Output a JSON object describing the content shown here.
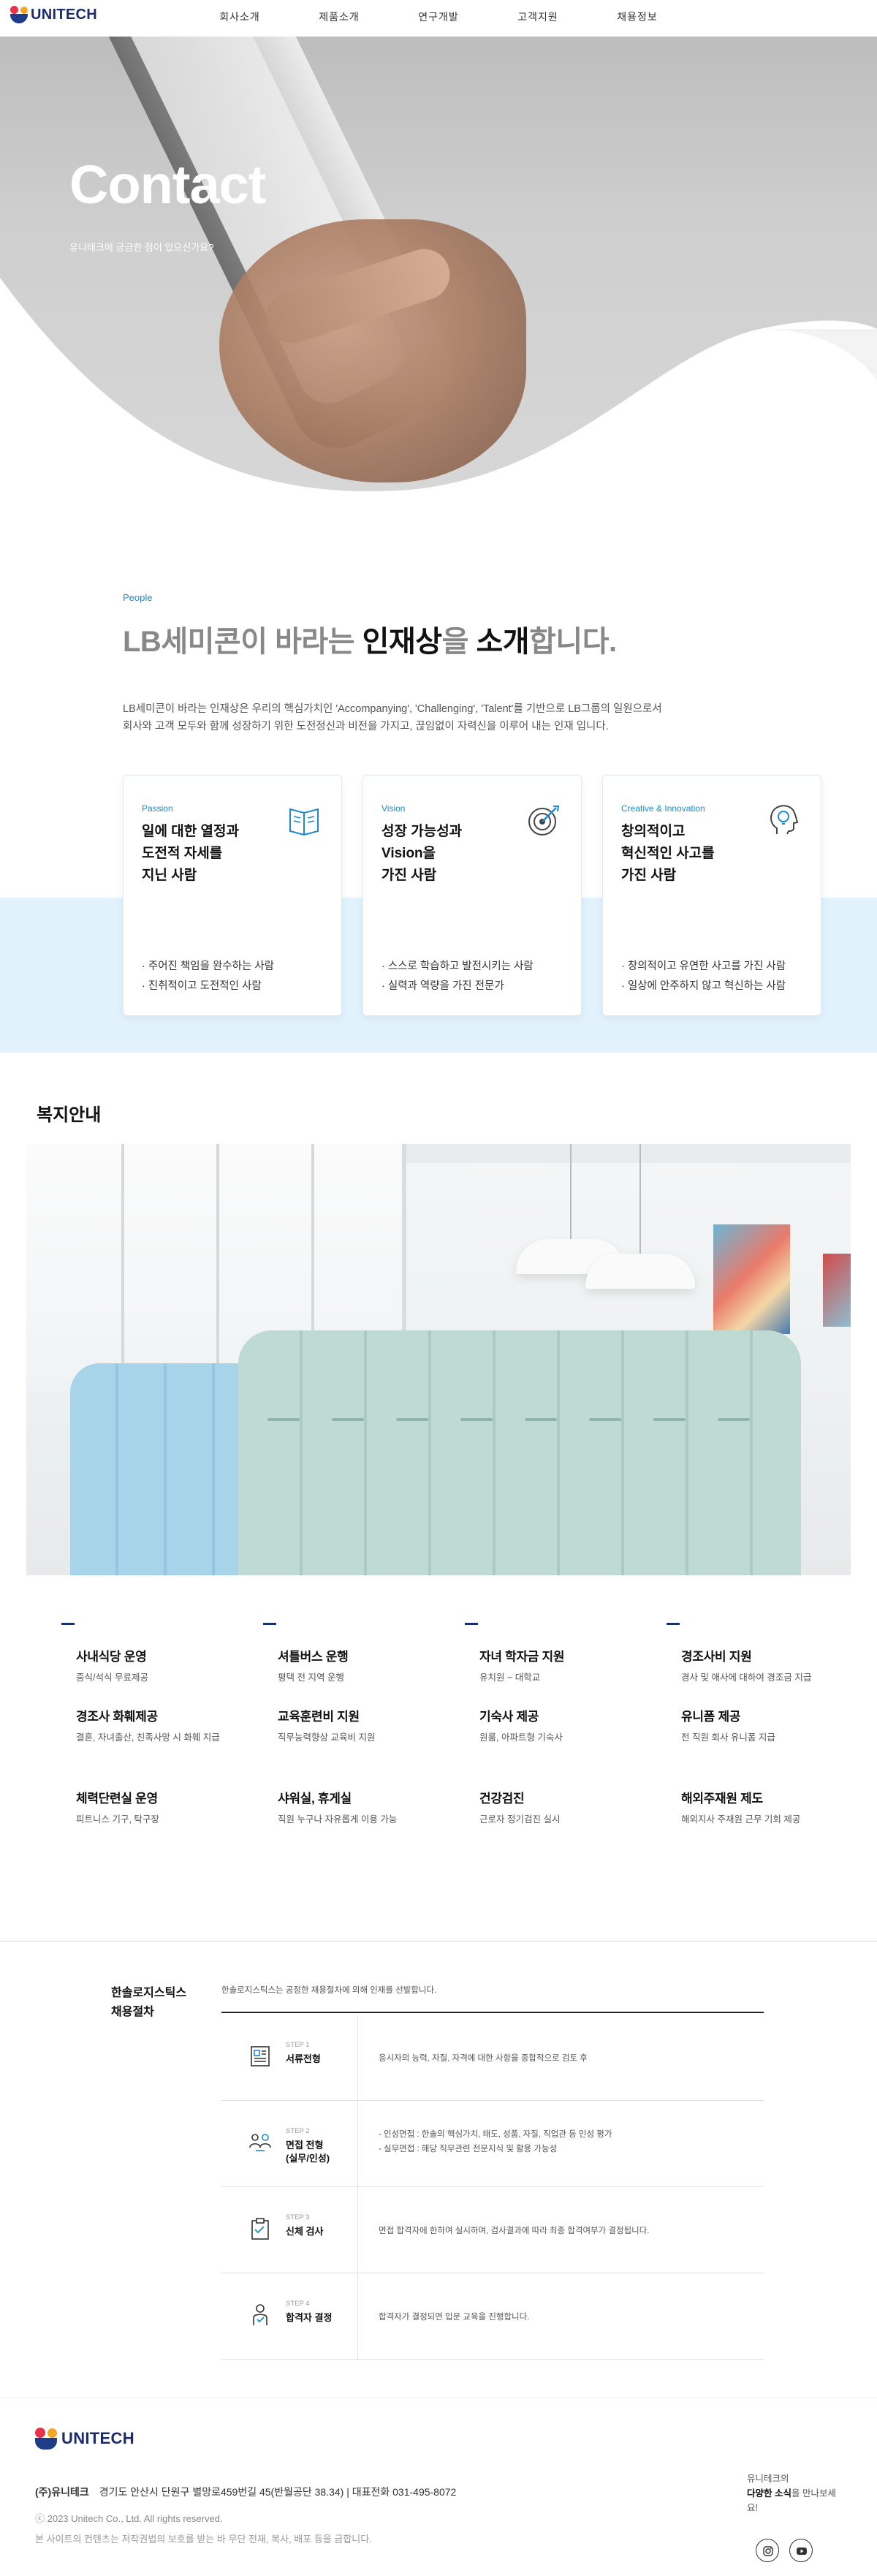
{
  "header": {
    "logo_text": "UNITECH",
    "nav": [
      "회사소개",
      "제품소개",
      "연구개발",
      "고객지원",
      "채용정보"
    ]
  },
  "hero": {
    "title": "Contact",
    "subtitle": "유니테크에 궁금한 점이 있으신가요?"
  },
  "people": {
    "eyebrow": "People",
    "title_pre": "LB세미콘이 바라는 ",
    "title_strong1": "인재상",
    "title_mid": "을 ",
    "title_strong2": "소개",
    "title_post": "합니다.",
    "desc_line1": "LB세미콘이 바라는 인재상은 우리의 핵심가치인 'Accompanying', 'Challenging', 'Talent'를 기반으로 LB그룹의 일원으로서",
    "desc_line2": "회사와 고객 모두와 함께 성장하기 위한 도전정신과 비전을 가지고, 끊임없이 자력신을 이루어 내는 인재 입니다.",
    "cards": [
      {
        "key": "Passion",
        "title": "일에 대한 열정과\n도전적 자세를\n지닌 사람",
        "icon": "book-icon",
        "items": [
          "주어진 책임을 완수하는 사람",
          "진취적이고 도전적인 사람"
        ]
      },
      {
        "key": "Vision",
        "title": "성장 가능성과\nVision을\n가진 사람",
        "icon": "target-icon",
        "items": [
          "스스로 학습하고 발전시키는 사람",
          "실력과 역량을 가진 전문가"
        ]
      },
      {
        "key": "Creative & Innovation",
        "title": "창의적이고\n혁신적인 사고를\n가진 사람",
        "icon": "lightbulb-head-icon",
        "items": [
          "창의적이고 유연한 사고를 가진 사람",
          "일상에 안주하지 않고 혁신하는 사람"
        ]
      }
    ]
  },
  "welfare": {
    "title": "복지안내",
    "items": [
      {
        "title": "사내식당 운영",
        "desc": "중식/석식 무료제공"
      },
      {
        "title": "셔틀버스 운행",
        "desc": "평택 전 지역 운행"
      },
      {
        "title": "자녀 학자금 지원",
        "desc": "유치원 ~ 대학교"
      },
      {
        "title": "경조사비 지원",
        "desc": "경사 및 애사에 대하여 경조금 지급"
      },
      {
        "title": "경조사 화훼제공",
        "desc": "결혼, 자녀출산, 친족사망 시 화훼 지급"
      },
      {
        "title": "교육훈련비 지원",
        "desc": "직무능력향상 교육비 지원"
      },
      {
        "title": "기숙사 제공",
        "desc": "원룸, 아파트형 기숙사"
      },
      {
        "title": "유니폼 제공",
        "desc": "전 직원 회사 유니폼 지급"
      },
      {
        "title": "체력단련실 운영",
        "desc": "피트니스 기구, 탁구장"
      },
      {
        "title": "샤워실, 휴게실",
        "desc": "직원 누구나 자유롭게 이용 가능"
      },
      {
        "title": "건강검진",
        "desc": "근로자 정기검진 실시"
      },
      {
        "title": "해외주재원 제도",
        "desc": "해외지사 주재원 근무 기회 제공"
      }
    ]
  },
  "recruit": {
    "title_line1": "한솔로지스틱스",
    "title_line2": "채용절차",
    "lead": "한솔로지스틱스는 공정한 채용절차에 의해 인재를 선발합니다.",
    "steps": [
      {
        "no": "STEP 1",
        "title": "서류전형",
        "icon": "document-icon",
        "desc": [
          "응시자의 능력, 자질, 자격에 대한 사항을 종합적으로 검토 후"
        ]
      },
      {
        "no": "STEP 2",
        "title": "면접 전형\n(실무/인성)",
        "icon": "people-icon",
        "desc": [
          "- 인성면접 : 한솔의 핵심가치, 태도, 성품, 자질, 직업관 등 인성 평가",
          "- 실무면접 : 해당 직무관련 전문지식 및 활용 가능성"
        ]
      },
      {
        "no": "STEP 3",
        "title": "신체 검사",
        "icon": "clipboard-icon",
        "desc": [
          "면접 합격자에 한하여 실시하며, 검사결과에 따라 최종 합격여부가 결정됩니다."
        ]
      },
      {
        "no": "STEP 4",
        "title": "합격자 결정",
        "icon": "person-check-icon",
        "desc": [
          "합격자가 결정되면 입문 교육을 진행합니다."
        ]
      }
    ]
  },
  "footer": {
    "logo_text": "UNITECH",
    "company": "(주)유니테크",
    "address": "경기도 안산시 단원구 별망로459번길 45(반월공단 38.34)",
    "tel": "대표전화 031-495-8072",
    "copyright": "ⓒ 2023 Unitech Co., Ltd. All rights reserved.",
    "notice": "본 사이트의 컨텐츠는 저작권법의 보호를 받는 바 무단 전재, 복사, 배포 등을 금합니다.",
    "tag_line1": "유니테크의",
    "tag_strong": "다양한 소식",
    "tag_line2": "을 만나보세요!",
    "sns": [
      "instagram-icon",
      "youtube-icon"
    ]
  }
}
